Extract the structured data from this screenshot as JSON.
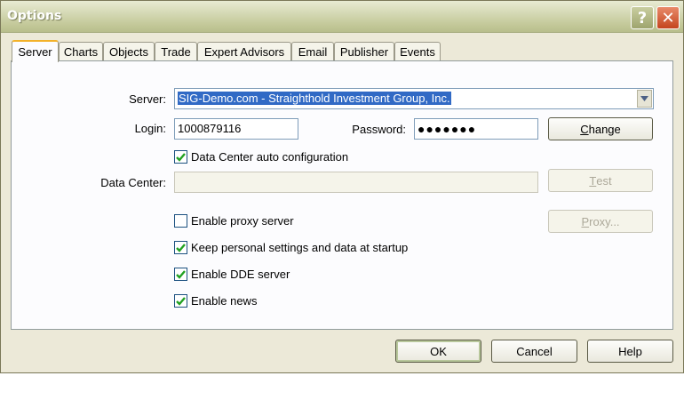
{
  "window": {
    "title": "Options",
    "help_glyph": "?",
    "close_glyph": "✕"
  },
  "tabs": [
    {
      "label": "Server"
    },
    {
      "label": "Charts"
    },
    {
      "label": "Objects"
    },
    {
      "label": "Trade"
    },
    {
      "label": "Expert Advisors"
    },
    {
      "label": "Email"
    },
    {
      "label": "Publisher"
    },
    {
      "label": "Events"
    }
  ],
  "active_tab": "Server",
  "server": {
    "server_label": "Server:",
    "server_value": "SIG-Demo.com - Straighthold Investment Group, Inc.",
    "login_label": "Login:",
    "login_value": "1000879116",
    "password_label": "Password:",
    "password_value": "●●●●●●●",
    "change_label_pre": "",
    "change_label_key": "C",
    "change_label_post": "hange",
    "data_center_auto_label": "Data Center auto configuration",
    "data_center_auto_checked": true,
    "data_center_label": "Data Center:",
    "data_center_value": "",
    "test_label_key": "T",
    "test_label_post": "est",
    "proxy_enable_label": "Enable proxy server",
    "proxy_enable_checked": false,
    "proxy_label_key": "P",
    "proxy_label_post": "roxy...",
    "keep_settings_label": "Keep personal settings and data at startup",
    "keep_settings_checked": true,
    "dde_label": "Enable DDE server",
    "dde_checked": true,
    "news_label": "Enable news",
    "news_checked": true
  },
  "footer": {
    "ok_label": "OK",
    "cancel_label": "Cancel",
    "help_label": "Help"
  },
  "colors": {
    "checkmark": "#21a121",
    "selection": "#316ac5",
    "tab_accent": "#f3b22a"
  }
}
